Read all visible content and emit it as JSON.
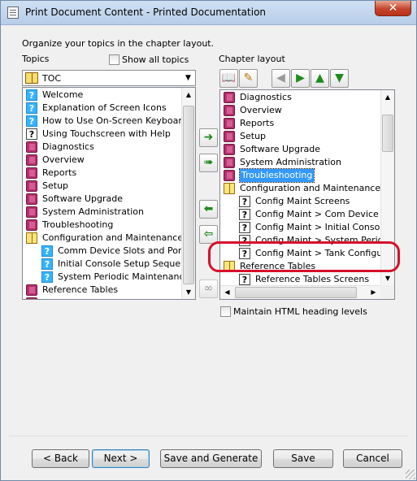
{
  "window": {
    "title": "Print Document Content - Printed Documentation",
    "close_symbol": "✕"
  },
  "instruction": "Organize your topics in the chapter layout.",
  "topics": {
    "label": "Topics",
    "show_all_label": "Show all topics",
    "combo_value": "TOC",
    "combo_arrow": "▼",
    "items": [
      {
        "icon": "help-icon",
        "label": "Welcome"
      },
      {
        "icon": "help-icon",
        "label": "Explanation of Screen Icons"
      },
      {
        "icon": "help-icon",
        "label": "How to Use On-Screen Keyboard"
      },
      {
        "icon": "page-icon",
        "label": "Using Touchscreen with Help"
      },
      {
        "icon": "book-icon",
        "label": "Diagnostics"
      },
      {
        "icon": "book-icon",
        "label": "Overview"
      },
      {
        "icon": "book-icon",
        "label": "Reports"
      },
      {
        "icon": "book-icon",
        "label": "Setup"
      },
      {
        "icon": "book-icon",
        "label": "Software Upgrade"
      },
      {
        "icon": "book-icon",
        "label": "System Administration"
      },
      {
        "icon": "book-icon",
        "label": "Troubleshooting"
      },
      {
        "icon": "open-book-icon",
        "label": "Configuration and Maintenance"
      },
      {
        "icon": "help-icon",
        "label": "Comm Device Slots and Ports"
      },
      {
        "icon": "help-icon",
        "label": "Initial Console Setup Sequence"
      },
      {
        "icon": "help-icon",
        "label": "System Periodic Maintenance"
      },
      {
        "icon": "book-icon",
        "label": "Reference Tables"
      },
      {
        "icon": "book-icon",
        "label": "Understanding ATG"
      }
    ]
  },
  "chapter": {
    "label": "Chapter layout",
    "items": [
      {
        "icon": "book-icon",
        "label": "Diagnostics"
      },
      {
        "icon": "book-icon",
        "label": "Overview"
      },
      {
        "icon": "book-icon",
        "label": "Reports"
      },
      {
        "icon": "book-icon",
        "label": "Setup"
      },
      {
        "icon": "book-icon",
        "label": "Software Upgrade"
      },
      {
        "icon": "book-icon",
        "label": "System Administration"
      },
      {
        "icon": "book-icon",
        "label": "Troubleshooting"
      },
      {
        "icon": "open-book-icon",
        "label": "Configuration and Maintenance"
      },
      {
        "icon": "page-icon",
        "label": "Config Maint Screens"
      },
      {
        "icon": "page-icon",
        "label": "Config Maint > Com Device Slots"
      },
      {
        "icon": "page-icon",
        "label": "Config Maint > Initial Console Se"
      },
      {
        "icon": "page-icon",
        "label": "Config Maint > System Periodic I"
      },
      {
        "icon": "page-icon",
        "label": "Config Maint > Tank Configuratio"
      },
      {
        "icon": "open-book-icon",
        "label": "Reference Tables"
      },
      {
        "icon": "page-icon",
        "label": "Reference Tables Screens"
      }
    ]
  },
  "maintain_heading_label": "Maintain HTML heading levels",
  "buttons": {
    "back": "< Back",
    "next": "Next >",
    "save_generate": "Save and Generate",
    "save": "Save",
    "cancel": "Cancel"
  },
  "symbols": {
    "arrow_right": "➜",
    "arrow_double_right": "➠",
    "arrow_left": "⬅",
    "arrow_double_left": "⇦",
    "glasses": "∞",
    "up": "▲",
    "down": "▼",
    "left": "◀",
    "right": "▶",
    "pencil": "✎",
    "book_glyph": "📖"
  },
  "colors": {
    "selection": "#3399ff",
    "annotation": "#d70f2b"
  }
}
